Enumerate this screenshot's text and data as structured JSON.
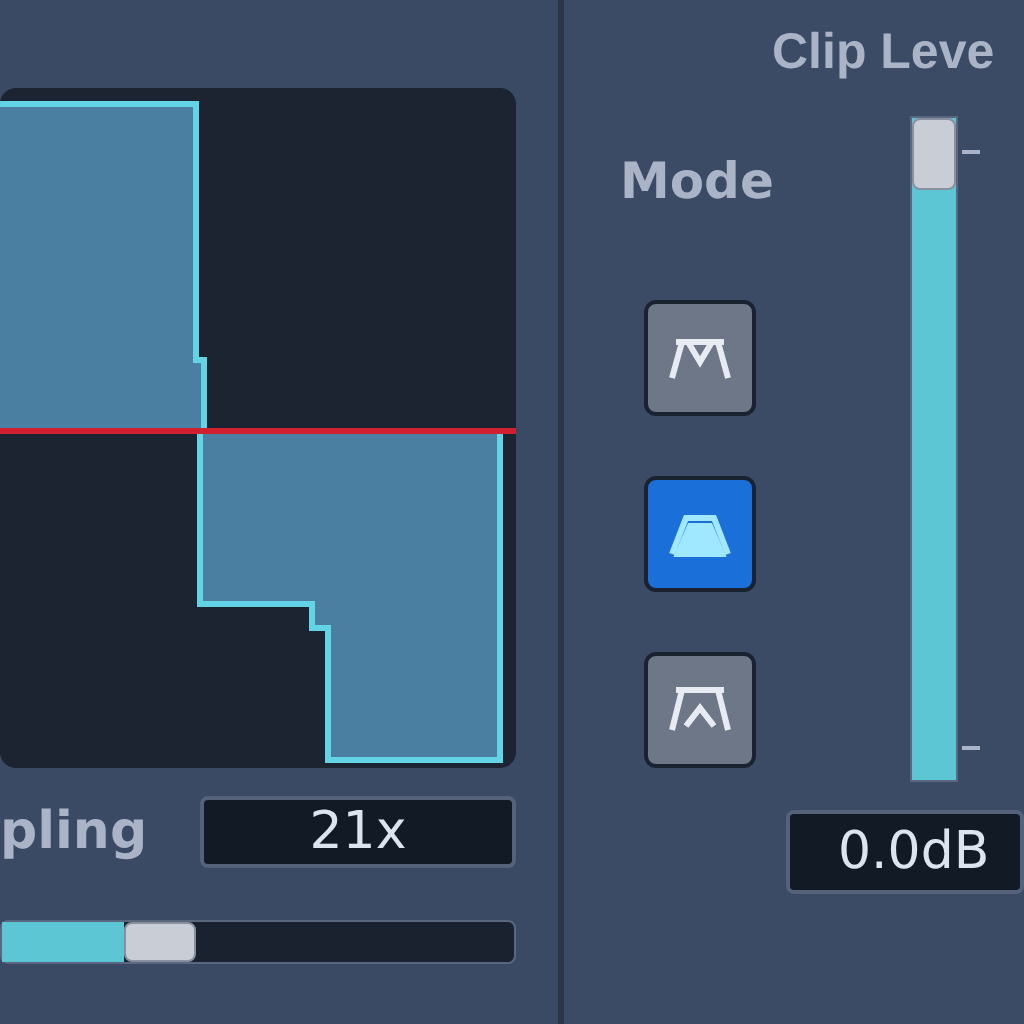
{
  "oversampling": {
    "label": "pling",
    "value": "21x",
    "slider": {
      "level": 0.24
    }
  },
  "clip_level": {
    "title": "Clip Leve",
    "slider": {
      "level": 1
    },
    "value": "0.0dB"
  },
  "mode": {
    "label": "Mode",
    "buttons": [
      {
        "kind": "flat",
        "selected": false
      },
      {
        "kind": "bell",
        "selected": true
      },
      {
        "kind": "peak",
        "selected": false
      }
    ]
  }
}
